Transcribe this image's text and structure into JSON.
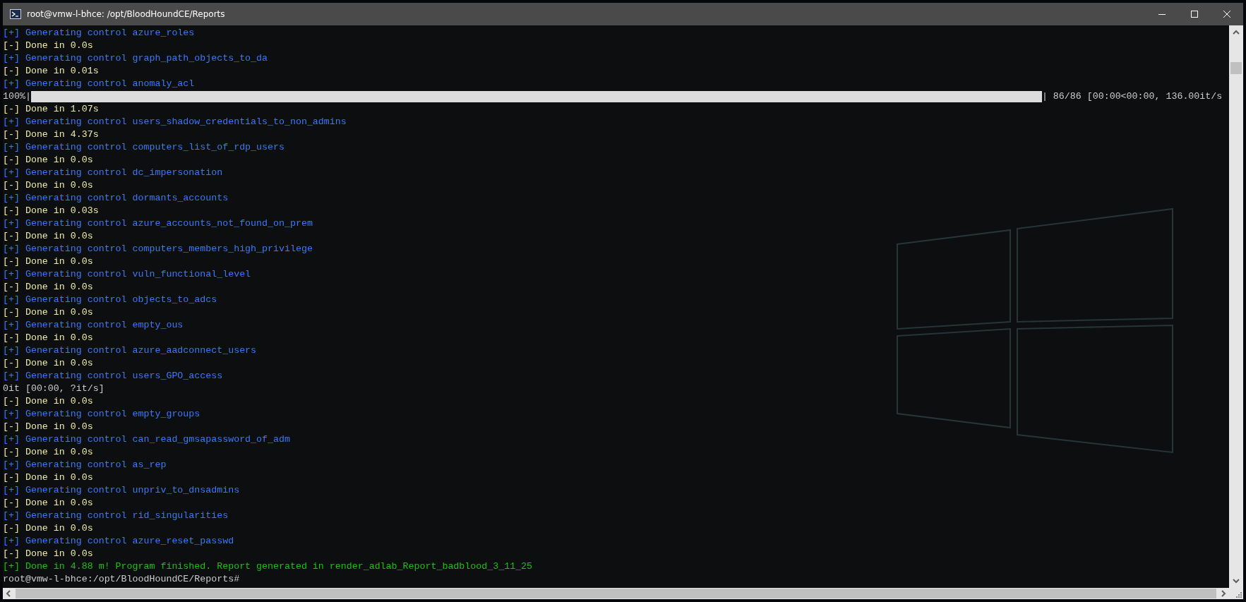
{
  "window": {
    "title": "root@vmw-l-bhce: /opt/BloodHoundCE/Reports"
  },
  "lines": [
    {
      "kind": "info",
      "text": "[+] Generating control azure_roles"
    },
    {
      "kind": "done",
      "text": "[-] Done in 0.0s"
    },
    {
      "kind": "info",
      "text": "[+] Generating control graph_path_objects_to_da"
    },
    {
      "kind": "done",
      "text": "[-] Done in 0.01s"
    },
    {
      "kind": "info",
      "text": "[+] Generating control anomaly_acl"
    },
    {
      "kind": "progress",
      "text": "100%|",
      "after": "| 86/86 [00:00<00:00, 136.00it/s",
      "level": 1
    },
    {
      "kind": "done",
      "text": "[-] Done in 1.07s"
    },
    {
      "kind": "info",
      "text": "[+] Generating control users_shadow_credentials_to_non_admins"
    },
    {
      "kind": "done",
      "text": "[-] Done in 4.37s"
    },
    {
      "kind": "info",
      "text": "[+] Generating control computers_list_of_rdp_users"
    },
    {
      "kind": "done",
      "text": "[-] Done in 0.0s"
    },
    {
      "kind": "info",
      "text": "[+] Generating control dc_impersonation"
    },
    {
      "kind": "done",
      "text": "[-] Done in 0.0s"
    },
    {
      "kind": "info",
      "text": "[+] Generating control dormants_accounts"
    },
    {
      "kind": "done",
      "text": "[-] Done in 0.03s"
    },
    {
      "kind": "info",
      "text": "[+] Generating control azure_accounts_not_found_on_prem"
    },
    {
      "kind": "done",
      "text": "[-] Done in 0.0s"
    },
    {
      "kind": "info",
      "text": "[+] Generating control computers_members_high_privilege"
    },
    {
      "kind": "done",
      "text": "[-] Done in 0.0s"
    },
    {
      "kind": "info",
      "text": "[+] Generating control vuln_functional_level"
    },
    {
      "kind": "done",
      "text": "[-] Done in 0.0s"
    },
    {
      "kind": "info",
      "text": "[+] Generating control objects_to_adcs"
    },
    {
      "kind": "done",
      "text": "[-] Done in 0.0s"
    },
    {
      "kind": "info",
      "text": "[+] Generating control empty_ous"
    },
    {
      "kind": "done",
      "text": "[-] Done in 0.0s"
    },
    {
      "kind": "info",
      "text": "[+] Generating control azure_aadconnect_users"
    },
    {
      "kind": "done",
      "text": "[-] Done in 0.0s"
    },
    {
      "kind": "info",
      "text": "[+] Generating control users_GPO_access"
    },
    {
      "kind": "plain",
      "text": "0it [00:00, ?it/s]"
    },
    {
      "kind": "done",
      "text": "[-] Done in 0.0s"
    },
    {
      "kind": "info",
      "text": "[+] Generating control empty_groups"
    },
    {
      "kind": "done",
      "text": "[-] Done in 0.0s"
    },
    {
      "kind": "info",
      "text": "[+] Generating control can_read_gmsapassword_of_adm"
    },
    {
      "kind": "done",
      "text": "[-] Done in 0.0s"
    },
    {
      "kind": "info",
      "text": "[+] Generating control as_rep"
    },
    {
      "kind": "done",
      "text": "[-] Done in 0.0s"
    },
    {
      "kind": "info",
      "text": "[+] Generating control unpriv_to_dnsadmins"
    },
    {
      "kind": "done",
      "text": "[-] Done in 0.0s"
    },
    {
      "kind": "info",
      "text": "[+] Generating control rid_singularities"
    },
    {
      "kind": "done",
      "text": "[-] Done in 0.0s"
    },
    {
      "kind": "info",
      "text": "[+] Generating control azure_reset_passwd"
    },
    {
      "kind": "done",
      "text": "[-] Done in 0.0s"
    },
    {
      "kind": "success",
      "text": "[+] Done in 4.88 m! Program finished. Report generated in render_adlab_Report_badblood_3_11_25"
    },
    {
      "kind": "prompt",
      "text": "root@vmw-l-bhce:/opt/BloodHoundCE/Reports#"
    }
  ]
}
